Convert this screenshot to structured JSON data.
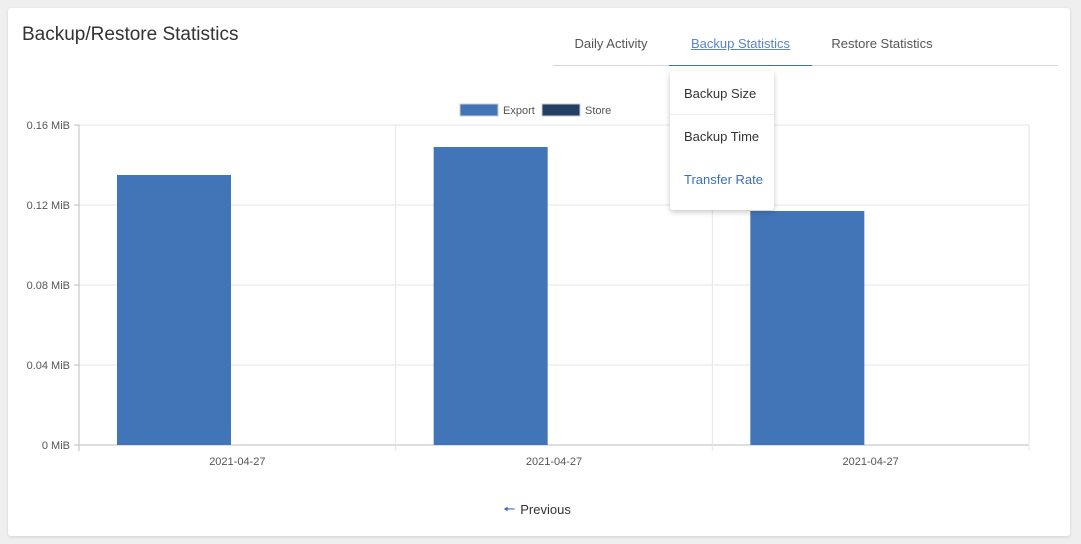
{
  "page": {
    "title": "Backup/Restore Statistics"
  },
  "tabs": [
    {
      "label": "Daily Activity"
    },
    {
      "label": "Backup Statistics"
    },
    {
      "label": "Restore Statistics"
    }
  ],
  "dropdown": {
    "items": [
      {
        "label": "Backup Size"
      },
      {
        "label": "Backup Time"
      },
      {
        "label": "Transfer Rate"
      }
    ]
  },
  "pagination": {
    "previous_label": "Previous",
    "icon": "arrow-left-icon"
  },
  "colors": {
    "export": "#4275b8",
    "store": "#233f66",
    "accent": "#3d6fb6"
  },
  "chart_data": {
    "type": "bar",
    "categories": [
      "2021-04-27",
      "2021-04-27",
      "2021-04-27"
    ],
    "series": [
      {
        "name": "Export",
        "values": [
          0.135,
          0.149,
          0.117
        ]
      },
      {
        "name": "Store",
        "values": [
          0,
          0,
          0
        ]
      }
    ],
    "y_ticks": [
      "0 MiB",
      "0.04 MiB",
      "0.08 MiB",
      "0.12 MiB",
      "0.16 MiB"
    ],
    "ylim": [
      0,
      0.16
    ],
    "unit": "MiB",
    "grid": true,
    "legend": "top-center"
  }
}
